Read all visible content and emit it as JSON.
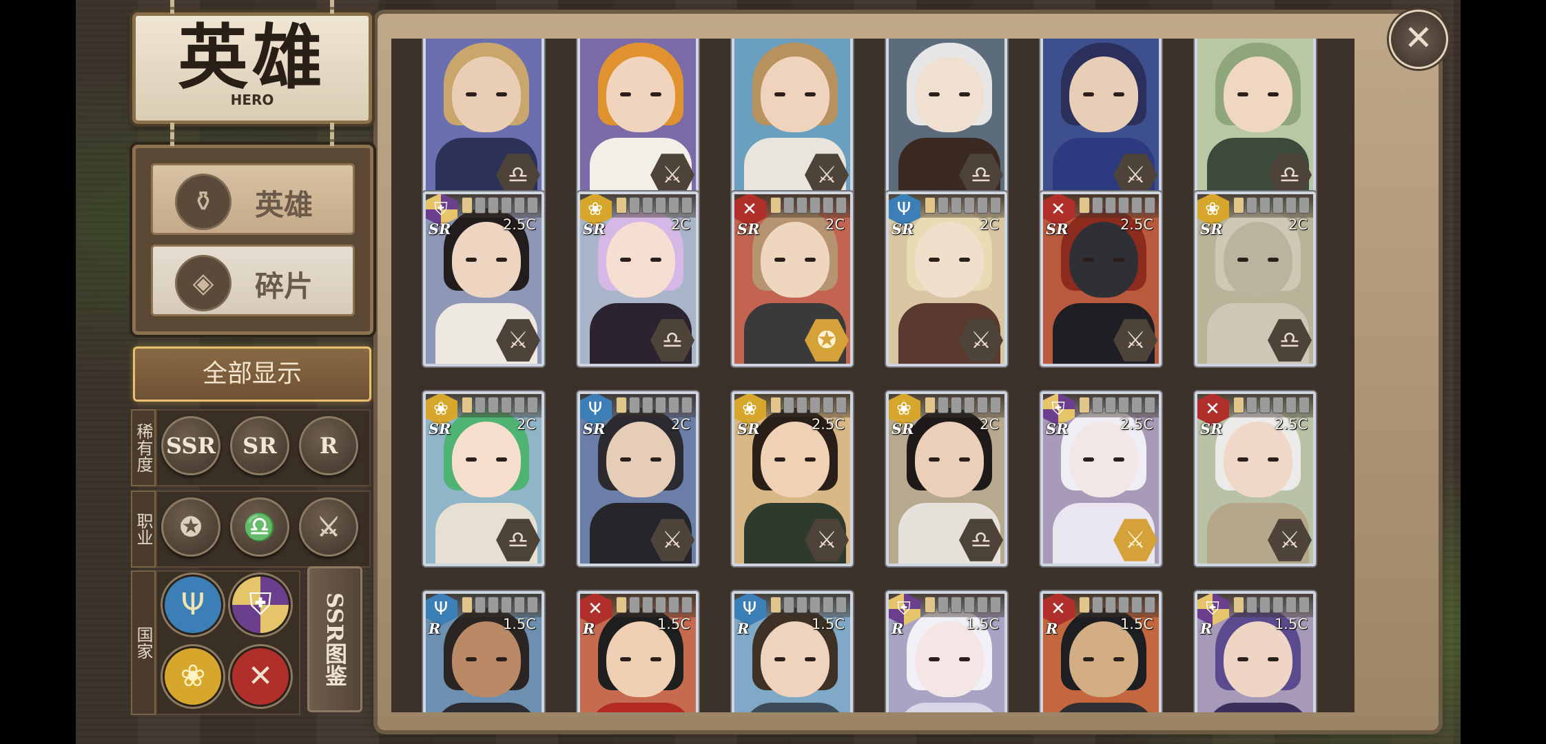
{
  "title": {
    "zh": "英雄",
    "en": "HERO"
  },
  "tabs": [
    {
      "label": "英雄",
      "icon": "bottle-icon"
    },
    {
      "label": "碎片",
      "icon": "shard-icon"
    }
  ],
  "show_all_label": "全部显示",
  "filters": {
    "rarity": {
      "label": "稀有度",
      "options": [
        "SSR",
        "SR",
        "R"
      ]
    },
    "class": {
      "label": "职业",
      "options": [
        "pentagram-icon",
        "horn-icon",
        "crossed-swords-icon"
      ]
    },
    "nation": {
      "label": "国家",
      "options": [
        "trident-nation-icon",
        "shield-nation-icon",
        "lotus-nation-icon",
        "crossed-weapons-nation-icon"
      ]
    }
  },
  "ssr_dex_label": "SSR图鉴",
  "close_icon": "close-icon",
  "colors": {
    "frame_silver": "#cfd6e0",
    "class_gold": "#d5a23a",
    "show_all_glow": "#e9c06e"
  },
  "cards": [
    {
      "rarity": "",
      "cost": "",
      "faction": "",
      "class": "horn",
      "bg": "#6a6fb0",
      "hair": "#c9a66b",
      "skin": "#e9cdb4",
      "body": "#2c3158",
      "stars": 0,
      "partial": true
    },
    {
      "rarity": "",
      "cost": "",
      "faction": "",
      "class": "swords",
      "bg": "#7a6aa8",
      "hair": "#e0922e",
      "skin": "#f0d4bd",
      "body": "#f2eee8",
      "stars": 0,
      "partial": true
    },
    {
      "rarity": "",
      "cost": "",
      "faction": "",
      "class": "swords",
      "bg": "#6a9fc0",
      "hair": "#b7915e",
      "skin": "#efd3bc",
      "body": "#e9e4dc",
      "stars": 0,
      "partial": true
    },
    {
      "rarity": "",
      "cost": "",
      "faction": "",
      "class": "horn",
      "bg": "#5d6c7d",
      "hair": "#e6e6e6",
      "skin": "#efe0d2",
      "body": "#3a2a22",
      "stars": 0,
      "partial": true
    },
    {
      "rarity": "",
      "cost": "",
      "faction": "",
      "class": "swords",
      "bg": "#3d4f8c",
      "hair": "#2b2f5c",
      "skin": "#e8cdb7",
      "body": "#2d3a80",
      "stars": 0,
      "partial": true
    },
    {
      "rarity": "",
      "cost": "",
      "faction": "",
      "class": "horn",
      "bg": "#b9c7a4",
      "hair": "#8ea67a",
      "skin": "#efd7c1",
      "body": "#3c4a3c",
      "stars": 0,
      "partial": true
    },
    {
      "rarity": "SR",
      "cost": "2.5C",
      "faction": "shield",
      "class": "swords",
      "bg": "#8e96b6",
      "hair": "#231c1c",
      "skin": "#eed5c1",
      "body": "#ede8e2",
      "stars": 1
    },
    {
      "rarity": "SR",
      "cost": "2C",
      "faction": "lotus",
      "class": "horn",
      "bg": "#a9b4c8",
      "hair": "#d6b8e6",
      "skin": "#f4dfd2",
      "body": "#2b2430",
      "stars": 1
    },
    {
      "rarity": "SR",
      "cost": "2C",
      "faction": "weapons",
      "class": "pentagram",
      "bg": "#c26450",
      "hair": "#b69472",
      "skin": "#efd6bf",
      "body": "#3a3a3a",
      "stars": 1,
      "gold_class": true
    },
    {
      "rarity": "SR",
      "cost": "2C",
      "faction": "trident",
      "class": "swords",
      "bg": "#d9c7a3",
      "hair": "#e9dcb4",
      "skin": "#f1dfcb",
      "body": "#5a3a2e",
      "stars": 1
    },
    {
      "rarity": "SR",
      "cost": "2.5C",
      "faction": "weapons",
      "class": "swords",
      "bg": "#b95a3c",
      "hair": "#8d2b1f",
      "skin": "#2f2f36",
      "body": "#1e1e24",
      "stars": 1
    },
    {
      "rarity": "SR",
      "cost": "2C",
      "faction": "lotus",
      "class": "horn",
      "bg": "#b8b49a",
      "hair": "#cfc8b4",
      "skin": "#bab49e",
      "body": "#cfc7b5",
      "stars": 1
    },
    {
      "rarity": "SR",
      "cost": "2C",
      "faction": "lotus",
      "class": "horn",
      "bg": "#8fb6c8",
      "hair": "#4fb374",
      "skin": "#f5dfcc",
      "body": "#e6e0d2",
      "stars": 1
    },
    {
      "rarity": "SR",
      "cost": "2C",
      "faction": "trident",
      "class": "swords",
      "bg": "#6a7ea8",
      "hair": "#2a2a30",
      "skin": "#e6cdb8",
      "body": "#25252b",
      "stars": 1
    },
    {
      "rarity": "SR",
      "cost": "2.5C",
      "faction": "lotus",
      "class": "swords",
      "bg": "#d9b885",
      "hair": "#2a1e18",
      "skin": "#efd2b6",
      "body": "#2f3a2e",
      "stars": 1
    },
    {
      "rarity": "SR",
      "cost": "2C",
      "faction": "lotus",
      "class": "horn",
      "bg": "#b6a98e",
      "hair": "#1f1a1a",
      "skin": "#eccfb8",
      "body": "#e6e1da",
      "stars": 1
    },
    {
      "rarity": "SR",
      "cost": "2.5C",
      "faction": "shield",
      "class": "swords",
      "bg": "#a79bb9",
      "hair": "#f0eef5",
      "skin": "#f3e6e6",
      "body": "#e9e6ef",
      "stars": 1,
      "gold_class": true
    },
    {
      "rarity": "SR",
      "cost": "2.5C",
      "faction": "weapons",
      "class": "swords",
      "bg": "#b9c2a4",
      "hair": "#ecebea",
      "skin": "#efd8c7",
      "body": "#b5a88a",
      "stars": 1
    },
    {
      "rarity": "R",
      "cost": "1.5C",
      "faction": "trident",
      "class": "swords",
      "bg": "#6d90b0",
      "hair": "#2a2522",
      "skin": "#b98a65",
      "body": "#2c2c30",
      "stars": 1,
      "partial": true
    },
    {
      "rarity": "R",
      "cost": "1.5C",
      "faction": "weapons",
      "class": "swords",
      "bg": "#c66a50",
      "hair": "#1e1e1e",
      "skin": "#efd0b4",
      "body": "#b22a22",
      "stars": 1,
      "partial": true
    },
    {
      "rarity": "R",
      "cost": "1.5C",
      "faction": "trident",
      "class": "swords",
      "bg": "#7fa9c6",
      "hair": "#3d3025",
      "skin": "#efd3bd",
      "body": "#3d4a58",
      "stars": 1,
      "partial": true
    },
    {
      "rarity": "R",
      "cost": "1.5C",
      "faction": "shield",
      "class": "swords",
      "bg": "#a7a4c4",
      "hair": "#f1f0f6",
      "skin": "#f4e6e4",
      "body": "#d9d6e8",
      "stars": 1,
      "partial": true
    },
    {
      "rarity": "R",
      "cost": "1.5C",
      "faction": "weapons",
      "class": "swords",
      "bg": "#c5673e",
      "hair": "#1c1e22",
      "skin": "#d3ae85",
      "body": "#2d2f33",
      "stars": 1,
      "partial": true
    },
    {
      "rarity": "R",
      "cost": "1.5C",
      "faction": "shield",
      "class": "swords",
      "bg": "#a79ab9",
      "hair": "#5a4a8e",
      "skin": "#efd5c4",
      "body": "#3a2e5a",
      "stars": 1,
      "partial": true
    }
  ]
}
